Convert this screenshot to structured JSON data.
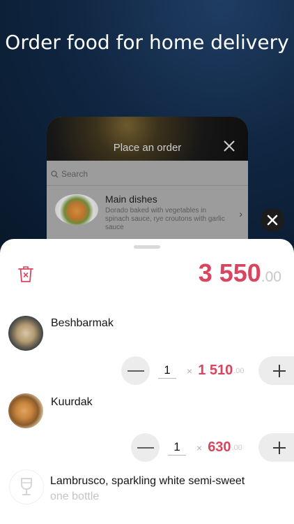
{
  "headline": "Order food for home delivery",
  "preview": {
    "title": "Place an order",
    "search_placeholder": "Search",
    "category": "Main dishes",
    "description": "Dorado baked with vegetables in spinach sauce, rye croutons with garlic sauce"
  },
  "cart": {
    "total_main": "3 550",
    "total_decimal": ".00",
    "items": [
      {
        "name": "Beshbarmak",
        "quantity": "1",
        "times": "×",
        "price": "1 510",
        "price_decimal": ".00"
      },
      {
        "name": "Kuurdak",
        "quantity": "1",
        "times": "×",
        "price": "630",
        "price_decimal": ".00"
      },
      {
        "name": "Lambrusco, sparkling white semi-sweet",
        "subtitle": "one bottle"
      }
    ]
  },
  "colors": {
    "accent": "#d9455f",
    "background": "#0f2540"
  },
  "icons": [
    "trash-icon",
    "close-icon",
    "minus-icon",
    "plus-icon",
    "wine-glass-icon",
    "search-icon",
    "chevron-right-icon"
  ]
}
